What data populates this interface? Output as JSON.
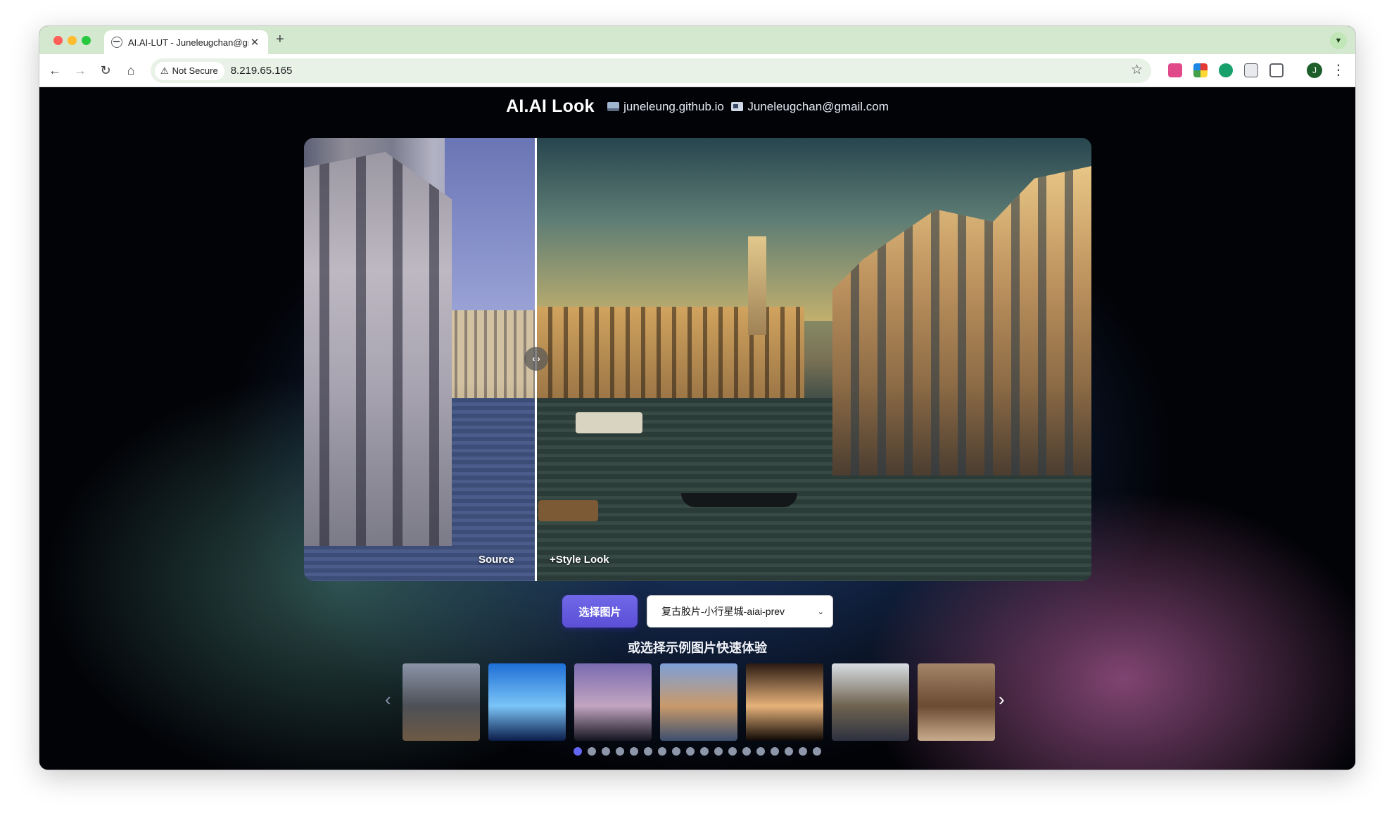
{
  "browser": {
    "tab_title": "AI.AI-LUT - Juneleugchan@gmail.com",
    "tab_close": "✕",
    "new_tab": "+",
    "security_label": "Not Secure",
    "url": "8.219.65.165",
    "profile_initial": "J"
  },
  "header": {
    "brand": "AI.AI Look",
    "site": "juneleung.github.io",
    "email": "Juneleugchan@gmail.com"
  },
  "viewer": {
    "source_label": "Source",
    "style_label": "+Style Look",
    "handle_glyph": "‹ ›",
    "split_fraction": 0.294
  },
  "controls": {
    "choose_label": "选择图片",
    "selected_style": "复古胶片-小行星城-aiai-prev",
    "hint": "或选择示例图片快速体验"
  },
  "carousel": {
    "prev": "‹",
    "next": "›",
    "thumbnails": [
      {
        "name": "graffiti-building",
        "colors": [
          "#8b95a8",
          "#4d5057",
          "#6d5a44"
        ]
      },
      {
        "name": "blue-spiral",
        "colors": [
          "#1e6fd6",
          "#7bc4f7",
          "#0b1d4a"
        ]
      },
      {
        "name": "silhouette-sunset",
        "colors": [
          "#7a6bb0",
          "#c2a5c0",
          "#141420"
        ]
      },
      {
        "name": "venice-canal",
        "colors": [
          "#7da0d8",
          "#c99a6a",
          "#3d4f6e"
        ]
      },
      {
        "name": "candle-portrait",
        "colors": [
          "#2a1a12",
          "#e7b27a",
          "#0e0805"
        ]
      },
      {
        "name": "woman-window",
        "colors": [
          "#d9dde3",
          "#6f6350",
          "#2d3140"
        ]
      },
      {
        "name": "dirt-bike",
        "colors": [
          "#a38569",
          "#6b4b32",
          "#c9ac8c"
        ]
      }
    ],
    "page_count": 18,
    "active_page": 0
  }
}
